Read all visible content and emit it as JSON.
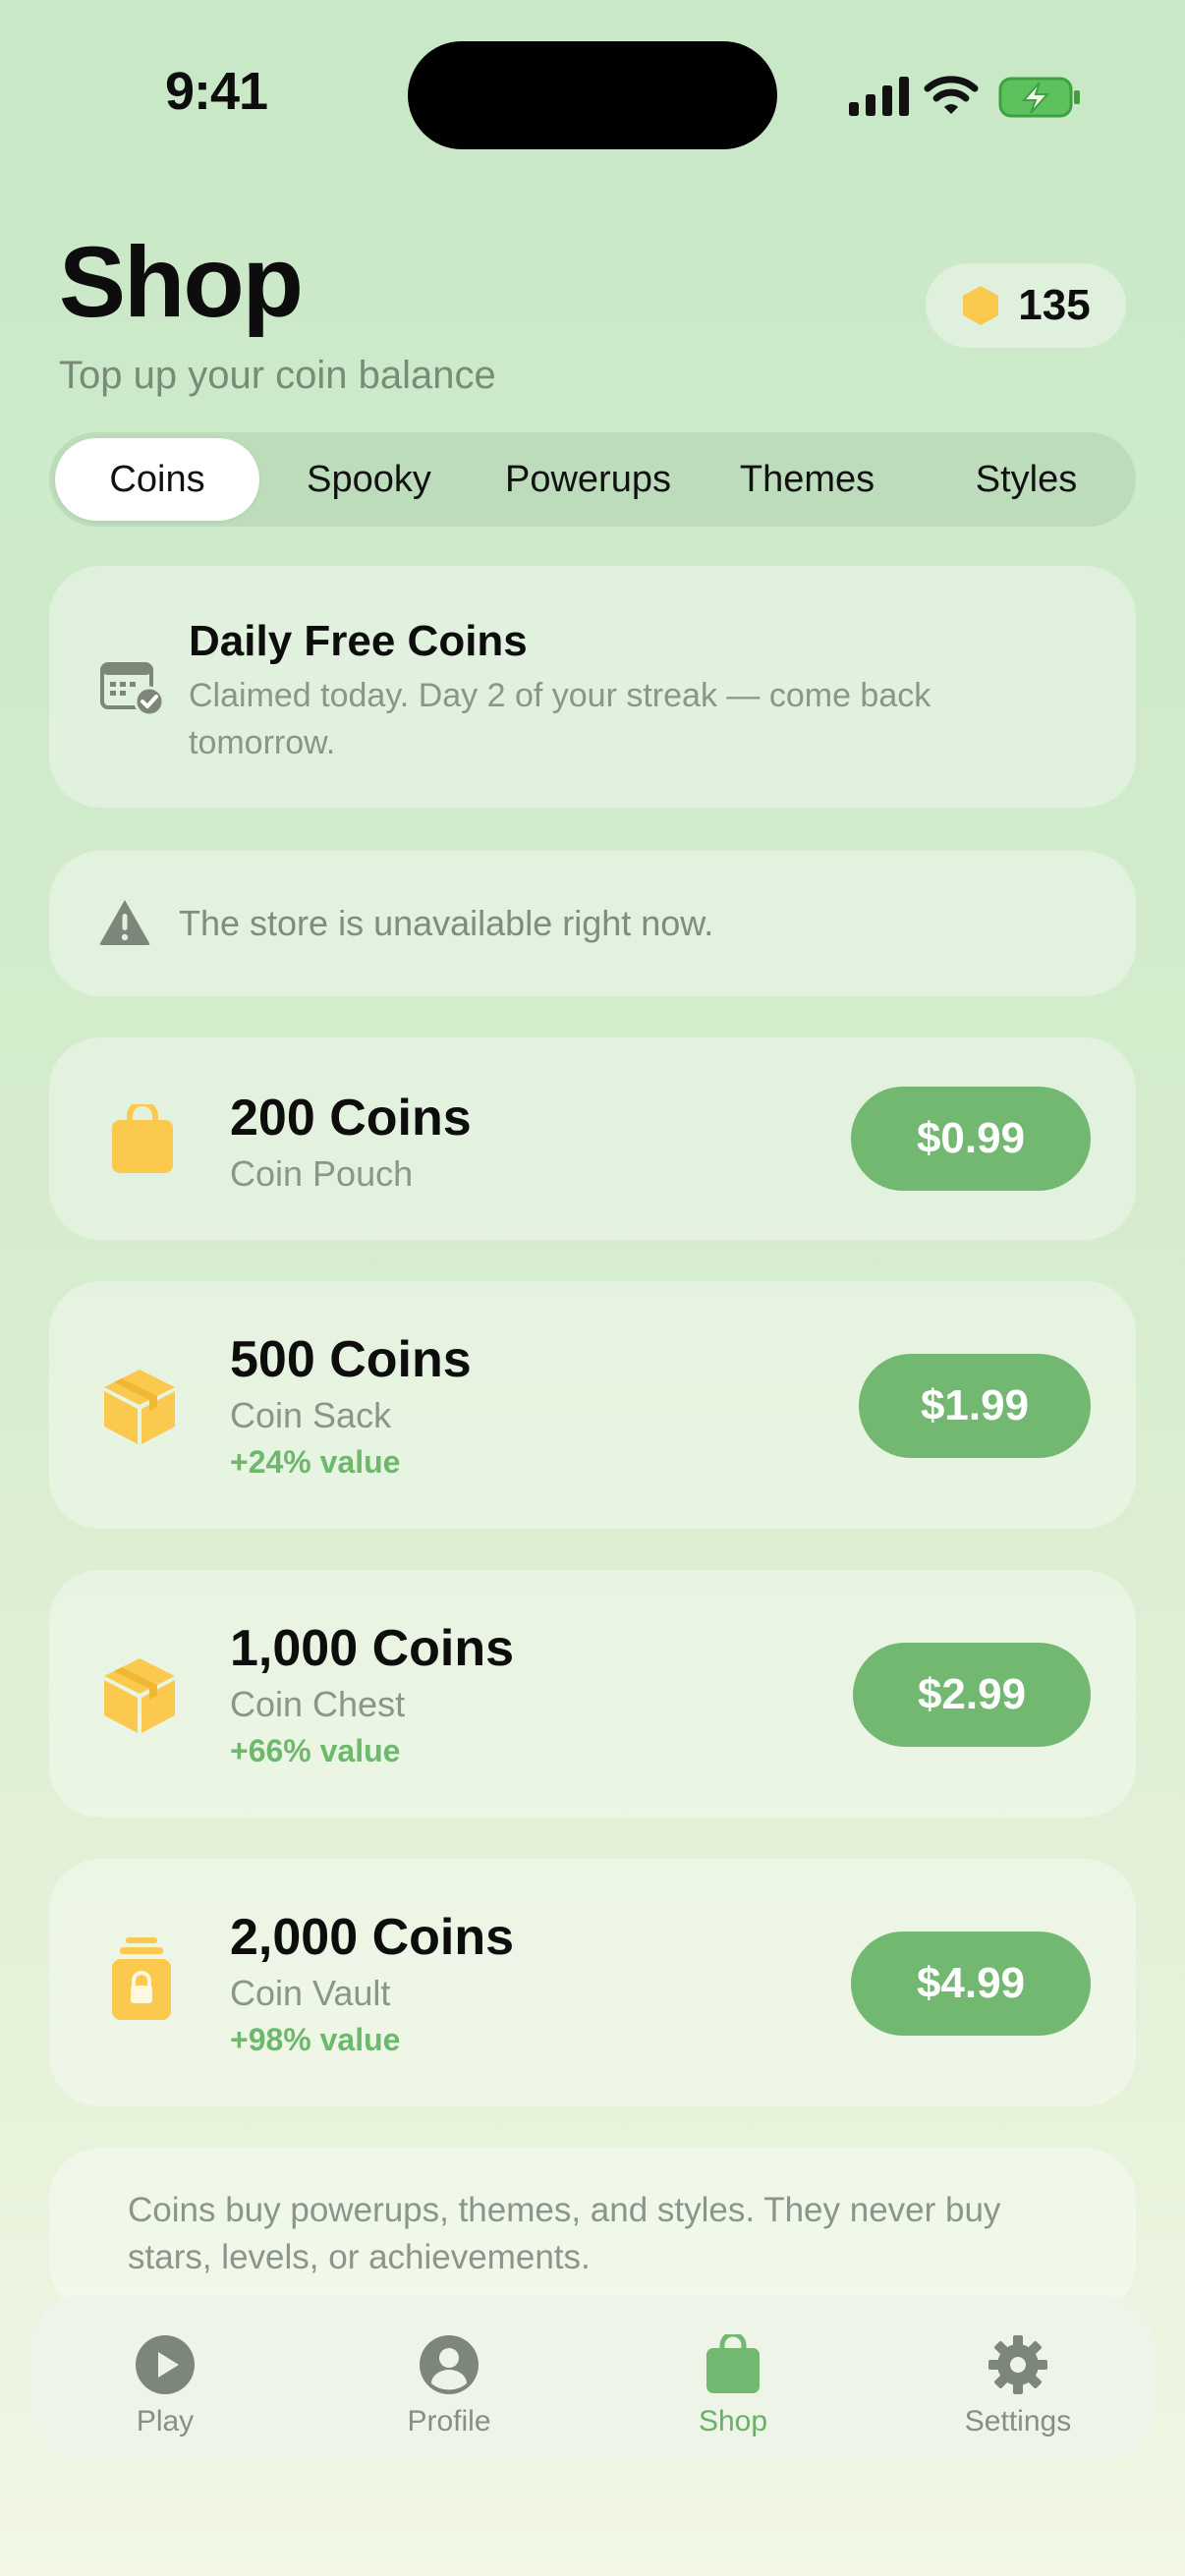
{
  "status_bar": {
    "time": "9:41"
  },
  "header": {
    "title": "Shop",
    "subtitle": "Top up your coin balance",
    "coin_balance": "135"
  },
  "tabs": [
    {
      "label": "Coins",
      "active": true
    },
    {
      "label": "Spooky",
      "active": false
    },
    {
      "label": "Powerups",
      "active": false
    },
    {
      "label": "Themes",
      "active": false
    },
    {
      "label": "Styles",
      "active": false
    }
  ],
  "daily": {
    "title": "Daily Free Coins",
    "description": "Claimed today. Day 2 of your streak — come back tomorrow.",
    "icon": "calendar-check-icon"
  },
  "warning": {
    "text": "The store is unavailable right now.",
    "icon": "warning-triangle-icon"
  },
  "products": [
    {
      "coins": "200 Coins",
      "name": "Coin Pouch",
      "bonus": "",
      "price": "$0.99",
      "icon": "bag-icon"
    },
    {
      "coins": "500 Coins",
      "name": "Coin Sack",
      "bonus": "+24% value",
      "price": "$1.99",
      "icon": "box-icon"
    },
    {
      "coins": "1,000 Coins",
      "name": "Coin Chest",
      "bonus": "+66% value",
      "price": "$2.99",
      "icon": "box-icon"
    },
    {
      "coins": "2,000 Coins",
      "name": "Coin Vault",
      "bonus": "+98% value",
      "price": "$4.99",
      "icon": "lock-icon"
    }
  ],
  "footnote": "Coins buy powerups, themes, and styles. They never buy stars, levels, or achievements.",
  "tab_bar": [
    {
      "label": "Play",
      "icon": "play-icon",
      "active": false
    },
    {
      "label": "Profile",
      "icon": "person-icon",
      "active": false
    },
    {
      "label": "Shop",
      "icon": "bag-icon",
      "active": true
    },
    {
      "label": "Settings",
      "icon": "gear-icon",
      "active": false
    }
  ],
  "colors": {
    "accent": "#72b870",
    "coin": "#fcc94f",
    "muted_icon": "#7c877a"
  }
}
